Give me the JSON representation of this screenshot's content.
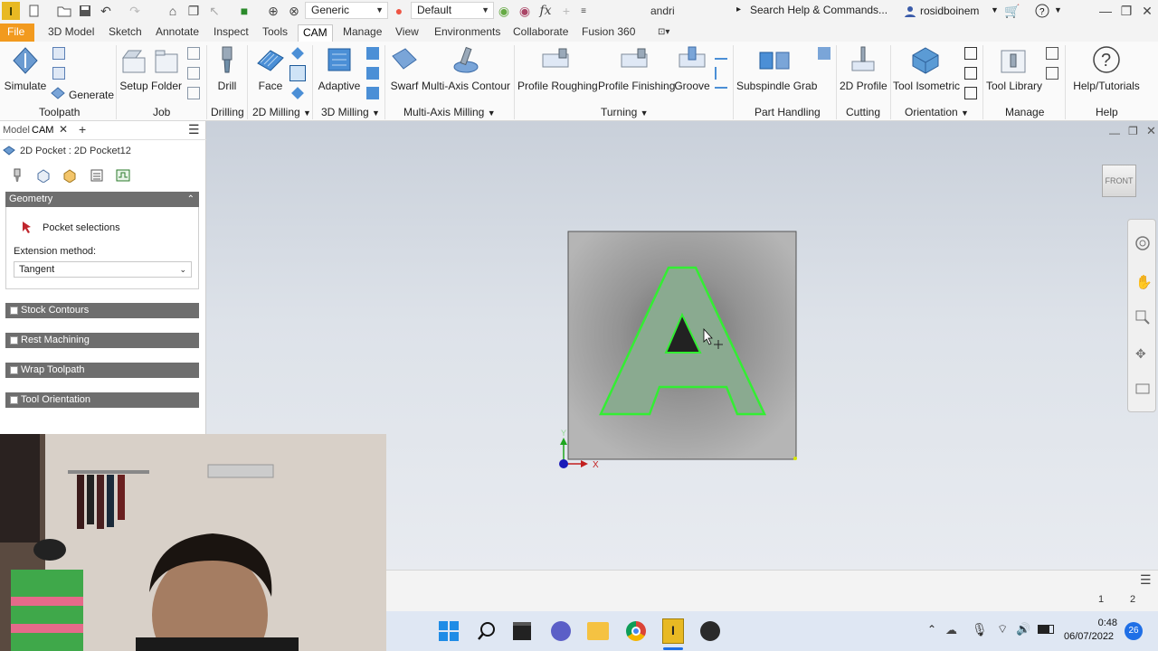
{
  "titlebar": {
    "appearance_dropdown": "Generic",
    "style_dropdown": "Default",
    "document_name": "andri",
    "search_placeholder": "Search Help & Commands...",
    "user_name": "rosidboinem"
  },
  "tabs": [
    "File",
    "3D Model",
    "Sketch",
    "Annotate",
    "Inspect",
    "Tools",
    "CAM",
    "Manage",
    "View",
    "Environments",
    "Collaborate",
    "Fusion 360"
  ],
  "active_tab": "CAM",
  "ribbon": {
    "buttons": {
      "simulate": "Simulate",
      "generate": "Generate",
      "setup": "Setup",
      "folder": "Folder",
      "drill": "Drill",
      "face": "Face",
      "adaptive": "Adaptive",
      "swarf": "Swarf",
      "multi_axis_contour": "Multi-Axis Contour",
      "profile_roughing": "Profile Roughing",
      "profile_finishing": "Profile Finishing",
      "groove": "Groove",
      "subspindle_grab": "Subspindle Grab",
      "profile_2d": "2D Profile",
      "tool_isometric": "Tool Isometric",
      "tool_library": "Tool Library",
      "help_tutorials": "Help/Tutorials"
    },
    "groups": {
      "toolpath": "Toolpath",
      "job": "Job",
      "drilling": "Drilling",
      "milling_2d": "2D Milling",
      "milling_3d": "3D Milling",
      "multi_axis": "Multi-Axis Milling",
      "turning": "Turning",
      "part_handling": "Part Handling",
      "cutting": "Cutting",
      "orientation": "Orientation",
      "manage": "Manage",
      "help": "Help"
    }
  },
  "browser": {
    "tab_model": "Model",
    "tab_cam": "CAM",
    "operation_title": "2D Pocket : 2D Pocket12",
    "geometry_section": "Geometry",
    "pocket_selections": "Pocket selections",
    "extension_method_label": "Extension method:",
    "extension_method_value": "Tangent",
    "sections": [
      "Stock Contours",
      "Rest Machining",
      "Wrap Toolpath",
      "Tool Orientation"
    ]
  },
  "viewport": {
    "viewcube_label": "FRONT",
    "axis_x": "X",
    "axis_y": "Y",
    "part_letter": "A"
  },
  "statusbar": {
    "page_1": "1",
    "page_2": "2"
  },
  "taskbar": {
    "time": "0:48",
    "date": "06/07/2022",
    "notification_count": "26"
  },
  "colors": {
    "file_tab": "#f29a1e",
    "section_header": "#6e6e6e",
    "highlight_green": "#33ee33",
    "part_face": "#8aaa90"
  }
}
